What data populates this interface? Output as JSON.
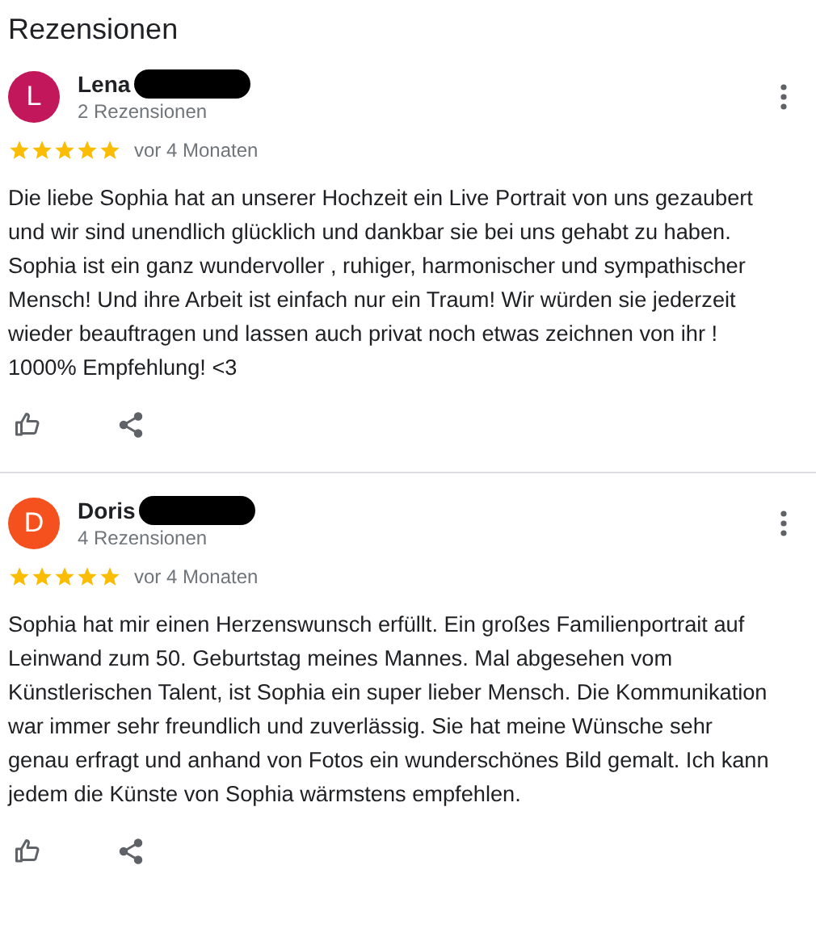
{
  "title": "Rezensionen",
  "reviews": [
    {
      "initial": "L",
      "color": "#c2185b",
      "name": "Lena",
      "name_redacted": true,
      "count": "2 Rezensionen",
      "stars": 5,
      "time": "vor 4 Monaten",
      "text": "Die liebe Sophia hat an unserer Hochzeit ein Live Portrait von uns gezaubert und wir sind unendlich glücklich und dankbar sie bei uns gehabt zu haben. Sophia ist ein ganz wundervoller , ruhiger, harmonischer und sympathischer Mensch! Und ihre Arbeit ist einfach nur ein Traum! Wir würden sie jederzeit wieder beauftragen und lassen auch privat noch etwas zeichnen von ihr ! 1000% Empfehlung! <3"
    },
    {
      "initial": "D",
      "color": "#f4511e",
      "name": "Doris",
      "name_redacted": true,
      "count": "4 Rezensionen",
      "stars": 5,
      "time": "vor 4 Monaten",
      "text": "Sophia hat mir einen Herzenswunsch erfüllt. Ein großes Familienportrait auf Leinwand zum 50. Geburtstag meines Mannes. Mal abgesehen vom Künstlerischen Talent, ist Sophia ein super lieber Mensch. Die Kommunikation war immer sehr freundlich und zuverlässig. Sie hat meine Wünsche sehr genau erfragt und anhand von Fotos ein wunderschönes Bild gemalt. Ich kann jedem die Künste von Sophia wärmstens empfehlen."
    }
  ]
}
